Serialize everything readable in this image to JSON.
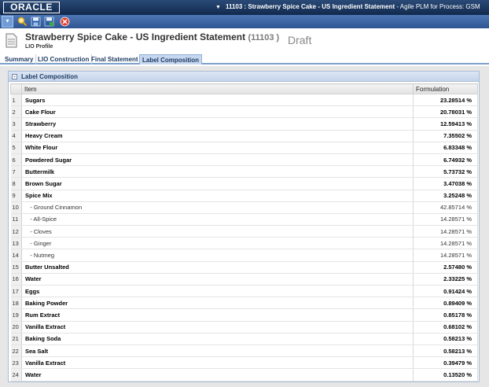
{
  "app": {
    "logo_text": "ORACLE",
    "window_title_main": "11103 : Strawberry Spice Cake - US Ingredient Statement",
    "window_title_suffix": " - Agile PLM for Process:  GSM"
  },
  "toolbar": {
    "icons": [
      "menu-icon",
      "search-icon",
      "save-icon",
      "save-as-icon",
      "close-icon"
    ]
  },
  "header": {
    "title": "Strawberry Spice Cake - US Ingredient Statement",
    "number": "(11103 )",
    "subtitle": "LIO Profile",
    "status": "Draft"
  },
  "tabs": [
    {
      "label": "Summary",
      "active": false
    },
    {
      "label": "LIO Construction",
      "active": false
    },
    {
      "label": "Final Statement",
      "active": false
    },
    {
      "label": "Label Composition",
      "active": true
    }
  ],
  "panel": {
    "title": "Label Composition",
    "columns": [
      "Item",
      "Formulation"
    ],
    "rows": [
      {
        "n": "1",
        "item": "Sugars",
        "value": "23.28514 %",
        "bold": true
      },
      {
        "n": "2",
        "item": "Cake Flour",
        "value": "20.78031 %",
        "bold": true
      },
      {
        "n": "3",
        "item": "Strawberry",
        "value": "12.59413 %",
        "bold": true
      },
      {
        "n": "4",
        "item": "Heavy Cream",
        "value": "7.35502 %",
        "bold": true
      },
      {
        "n": "5",
        "item": "White Flour",
        "value": "6.83348 %",
        "bold": true
      },
      {
        "n": "6",
        "item": "Powdered Sugar",
        "value": "6.74932 %",
        "bold": true
      },
      {
        "n": "7",
        "item": "Buttermilk",
        "value": "5.73732 %",
        "bold": true
      },
      {
        "n": "8",
        "item": "Brown Sugar",
        "value": "3.47038 %",
        "bold": true
      },
      {
        "n": "9",
        "item": "Spice Mix",
        "value": "3.25248 %",
        "bold": true
      },
      {
        "n": "10",
        "item": "   - Ground Cinnamon",
        "value": "42.85714 %",
        "bold": false
      },
      {
        "n": "11",
        "item": "   - All-Spice",
        "value": "14.28571 %",
        "bold": false
      },
      {
        "n": "12",
        "item": "   - Cloves",
        "value": "14.28571 %",
        "bold": false
      },
      {
        "n": "13",
        "item": "   - Ginger",
        "value": "14.28571 %",
        "bold": false
      },
      {
        "n": "14",
        "item": "   - Nutmeg",
        "value": "14.28571 %",
        "bold": false
      },
      {
        "n": "15",
        "item": "Butter Unsalted",
        "value": "2.57480 %",
        "bold": true
      },
      {
        "n": "16",
        "item": "Water",
        "value": "2.33225 %",
        "bold": true
      },
      {
        "n": "17",
        "item": "Eggs",
        "value": "0.91424 %",
        "bold": true
      },
      {
        "n": "18",
        "item": "Baking Powder",
        "value": "0.89409 %",
        "bold": true
      },
      {
        "n": "19",
        "item": "Rum Extract",
        "value": "0.85178 %",
        "bold": true
      },
      {
        "n": "20",
        "item": "Vanilla Extract",
        "value": "0.68102 %",
        "bold": true
      },
      {
        "n": "21",
        "item": "Baking Soda",
        "value": "0.58213 %",
        "bold": true
      },
      {
        "n": "22",
        "item": "Sea Salt",
        "value": "0.58213 %",
        "bold": true
      },
      {
        "n": "23",
        "item": "Vanilla Extract",
        "value": "0.39479 %",
        "bold": true
      },
      {
        "n": "24",
        "item": "Water",
        "value": "0.13520 %",
        "bold": true
      }
    ]
  }
}
